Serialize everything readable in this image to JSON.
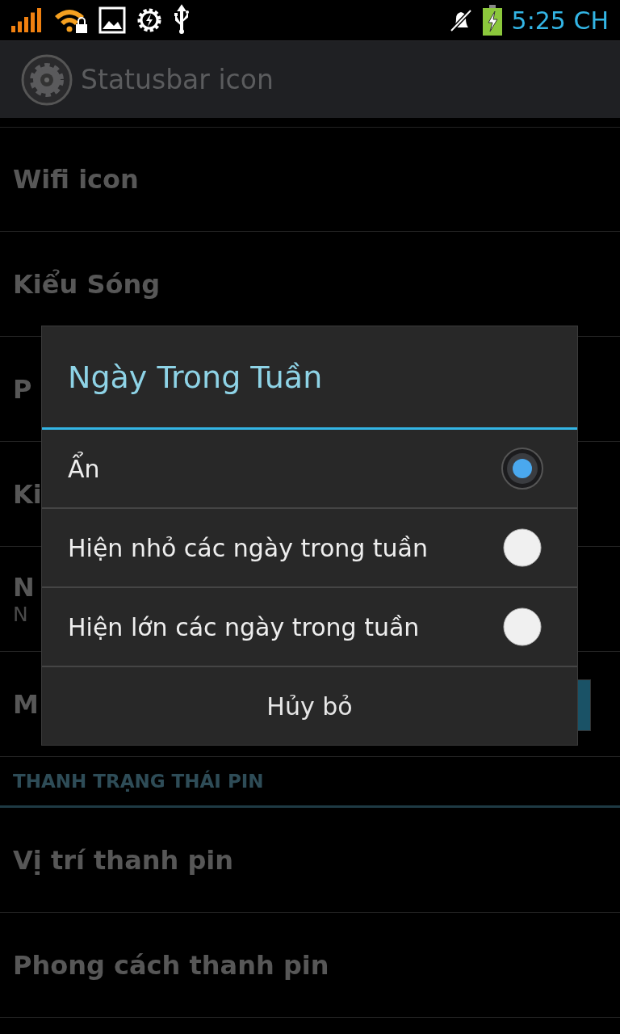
{
  "status_bar": {
    "time": "5:25 CH"
  },
  "action_bar": {
    "title": "Statusbar icon"
  },
  "settings": [
    {
      "kind": "item",
      "title": "Wifi icon"
    },
    {
      "kind": "item",
      "title": "Kiểu Sóng"
    },
    {
      "kind": "item",
      "title": "P"
    },
    {
      "kind": "item",
      "title": "Ki"
    },
    {
      "kind": "item",
      "title": "N",
      "summary": "N"
    },
    {
      "kind": "color",
      "title": "M",
      "color": "#1a5266"
    },
    {
      "kind": "header",
      "title": "THANH TRẠNG THÁI PIN"
    },
    {
      "kind": "item",
      "title": "Vị trí thanh pin"
    },
    {
      "kind": "item",
      "title": "Phong cách thanh pin"
    }
  ],
  "dialog": {
    "title": "Ngày Trong Tuần",
    "options": [
      {
        "label": "Ẩn",
        "selected": true
      },
      {
        "label": "Hiện nhỏ các ngày trong tuần",
        "selected": false
      },
      {
        "label": "Hiện lớn các ngày trong tuần",
        "selected": false
      }
    ],
    "buttons": [
      "Hủy bỏ"
    ]
  }
}
